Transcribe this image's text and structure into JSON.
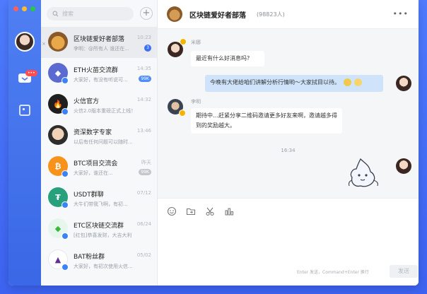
{
  "colors": {
    "accent": "#3d6ff5",
    "rail": "#4a79ef",
    "mine_bubble": "#cfe4fb"
  },
  "sidebar": {
    "badge": "•••",
    "icons": [
      "chat-icon",
      "contacts-icon"
    ]
  },
  "search": {
    "placeholder": "搜索"
  },
  "conversations": [
    {
      "name": "区块链爱好者部落",
      "time": "10:23",
      "preview": "李明：@所有人 谁还在...",
      "unread": "3",
      "avatar_color": "#e9a94a",
      "avatar_text": ""
    },
    {
      "name": "ETH火苗交流群",
      "time": "14:35",
      "preview": "大家好，有没有听说可...",
      "pill": "99K",
      "avatar_color": "#5b6ad0",
      "avatar_text": "◆"
    },
    {
      "name": "火信官方",
      "time": "14:32",
      "preview": "火信2.0版本重磅正式上线！",
      "avatar_color": "#1f1f1f",
      "avatar_text": "🔥"
    },
    {
      "name": "资深数字专家",
      "time": "13:46",
      "preview": "以后有任何问题可以随时...",
      "avatar_color": "#d9a27a",
      "avatar_text": ""
    },
    {
      "name": "BTC项目交流会",
      "time": "昨天",
      "preview": "大家好，谁还在...",
      "pill": "99K",
      "avatar_color": "#f7931a",
      "avatar_text": "₿"
    },
    {
      "name": "USDT群聊",
      "time": "07/12",
      "preview": "大牛们带我飞啊，有初...",
      "avatar_color": "#26a17b",
      "avatar_text": "₮"
    },
    {
      "name": "ETC区块链交流群",
      "time": "06/24",
      "preview": "[红包]恭喜发财，大吉大利",
      "avatar_color": "#3ab83a",
      "avatar_text": "◆"
    },
    {
      "name": "BAT粉丝群",
      "time": "05/02",
      "preview": "大家好，有初次使用火信...",
      "avatar_color": "#ffffff",
      "avatar_text": "▲"
    }
  ],
  "chat": {
    "title": "区块链爱好者部落",
    "member_count": "(98823人)",
    "timestamp": "16:34",
    "messages": [
      {
        "sender": "米娜",
        "text": "最近有什么好消息吗?"
      },
      {
        "sender": "",
        "text": "今晚有大佬给咱们讲解分析行情哟～大家拭目以待。"
      },
      {
        "sender": "李明",
        "text": "期待中…赶紧分享二维码邀请更多好友来啊，邀请越多得到的奖励越大。"
      }
    ]
  },
  "composer": {
    "hint": "Enter 发送，Command+Enter 换行",
    "send_label": "发送",
    "tools": [
      "emoji-icon",
      "folder-icon",
      "scissors-icon",
      "chart-icon"
    ]
  }
}
